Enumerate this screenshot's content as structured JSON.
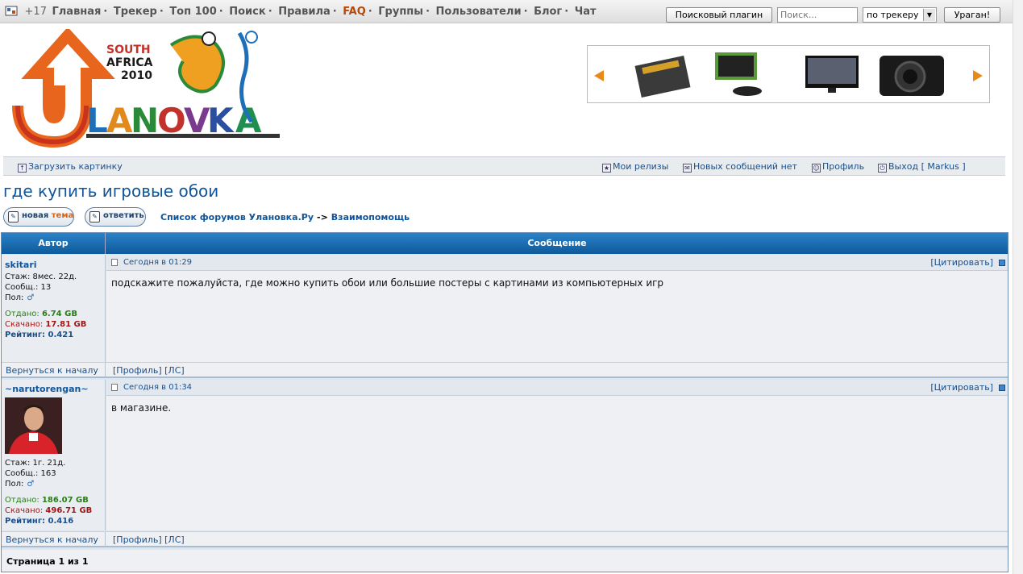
{
  "topnav": {
    "counter": "+17",
    "items": [
      "Главная",
      "Трекер",
      "Топ 100",
      "Поиск",
      "Правила",
      "FAQ",
      "Группы",
      "Пользователи",
      "Блог",
      "Чат"
    ],
    "separator": "·",
    "search_plugin_label": "Поисковый плагин",
    "search_placeholder": "Поиск...",
    "search_scope": "по трекеру",
    "search_go_label": "Ураган!"
  },
  "colors": {
    "nav_text": "#555555",
    "faq_accent": "#b5480d",
    "link_blue": "#10559a",
    "header_blue": "#0d5a9b",
    "uploaded_green": "#2a7d15",
    "downloaded_red": "#a31414"
  },
  "tools": {
    "upload_image": "Загрузить картинку",
    "my_releases": "Мои релизы",
    "no_new_messages": "Новых сообщений нет",
    "profile": "Профиль",
    "logout": "Выход [ Markus ]"
  },
  "topic": {
    "title": "где купить игровые обои",
    "new_topic_label": "новая",
    "new_topic_accent": "тема",
    "reply_label": "ответить",
    "breadcrumb_forum": "Список форумов Улановка.Ру",
    "breadcrumb_arrow": "->",
    "breadcrumb_section": "Взаимопомощь"
  },
  "table": {
    "col_author": "Автор",
    "col_message": "Сообщение",
    "quote_label": "[Цитировать]",
    "back_to_top": "Вернуться к началу",
    "profile_link": "[Профиль]",
    "pm_link": "[ЛС]",
    "page_info": "Страница 1 из 1"
  },
  "posts": [
    {
      "author": "skitari",
      "tenure": "Стаж: 8мес. 22д.",
      "messages": "Сообщ.: 13",
      "gender_label": "Пол:",
      "gender": "♂",
      "uploaded_label": "Отдано:",
      "uploaded": "6.74 GB",
      "downloaded_label": "Скачано:",
      "downloaded": "17.81 GB",
      "rating_label": "Рейтинг:",
      "rating": "0.421",
      "date": "Сегодня в 01:29",
      "body": "подскажите пожалуйста, где можно купить обои или большие постеры с картинами из компьютерных игр"
    },
    {
      "author": "~narutorengan~",
      "tenure": "Стаж: 1г. 21д.",
      "messages": "Сообщ.: 163",
      "gender_label": "Пол:",
      "gender": "♂",
      "uploaded_label": "Отдано:",
      "uploaded": "186.07 GB",
      "downloaded_label": "Скачано:",
      "downloaded": "496.71 GB",
      "rating_label": "Рейтинг:",
      "rating": "0.416",
      "date": "Сегодня в 01:34",
      "body": "в магазине."
    }
  ]
}
